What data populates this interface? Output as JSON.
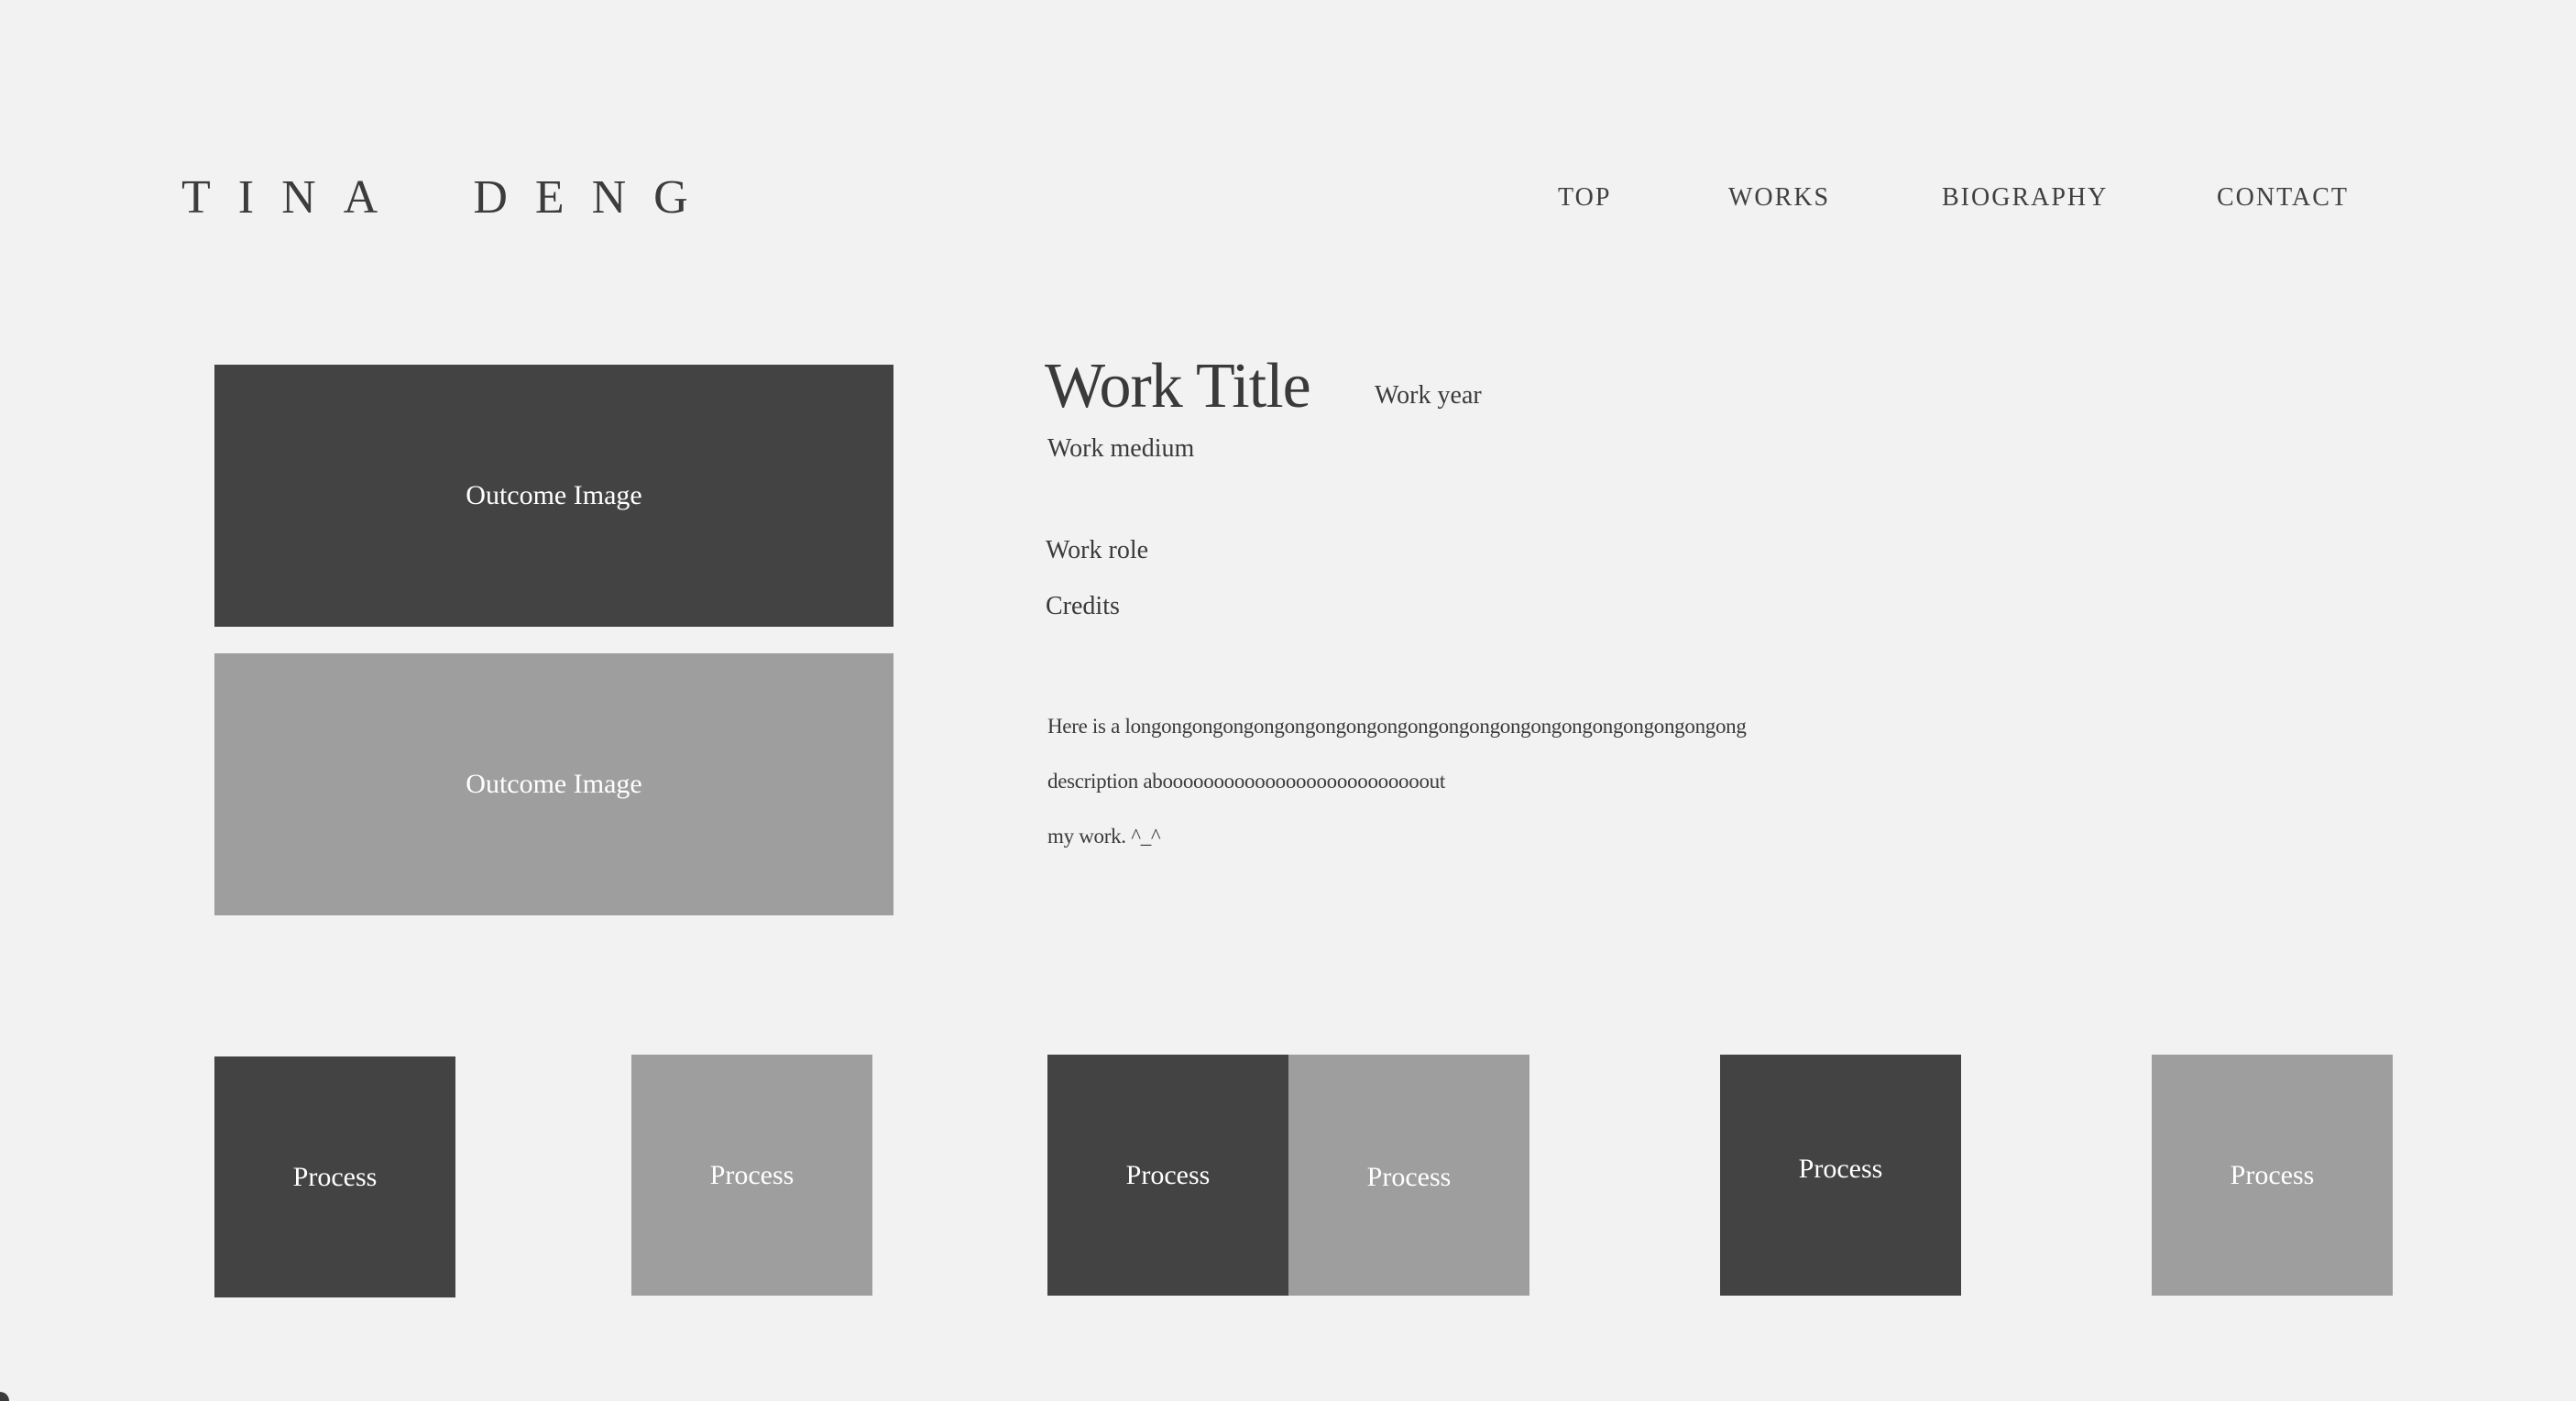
{
  "header": {
    "logo": "TINA DENG",
    "nav": [
      "TOP",
      "WORKS",
      "BIOGRAPHY",
      "CONTACT"
    ]
  },
  "work": {
    "title": "Work Title",
    "year": "Work year",
    "medium": "Work medium",
    "role": "Work role",
    "credits": "Credits",
    "description": [
      "Here is a longongongongongongongongongongongongongongongongongongongong",
      "description aboooooooooooooooooooooooooout",
      "my work. ^_^"
    ]
  },
  "outcome_images": [
    "Outcome Image",
    "Outcome Image"
  ],
  "process_images": [
    "Process",
    "Process",
    "Process",
    "Process",
    "Process",
    "Process"
  ],
  "colors": {
    "background": "#f2f2f2",
    "dark_block": "#434343",
    "light_block": "#9e9e9e",
    "text": "#3a3a3a"
  }
}
